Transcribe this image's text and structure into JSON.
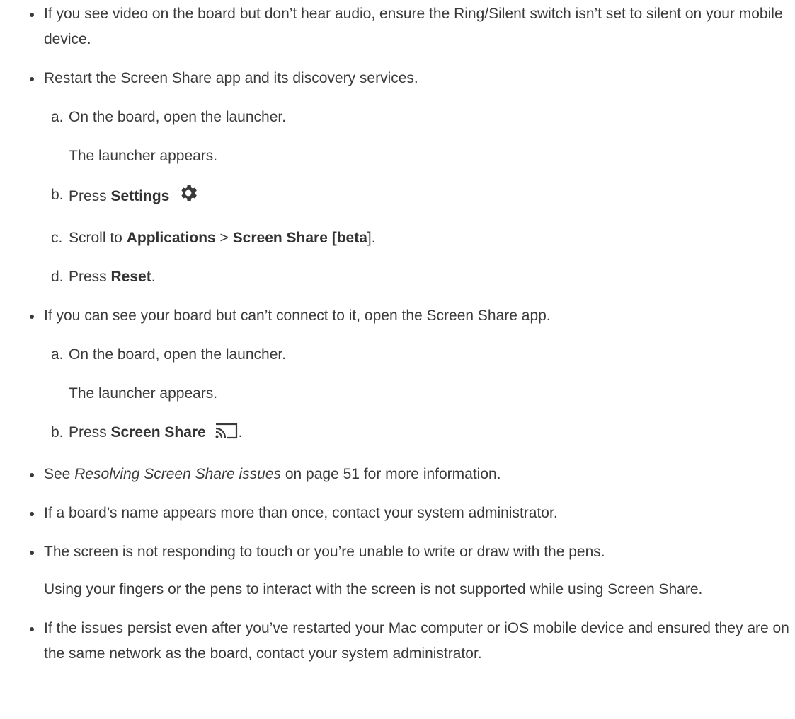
{
  "items": {
    "audio": {
      "text": "If you see video on the board but don’t hear audio, ensure the Ring/Silent switch isn’t set to silent on your mobile device."
    },
    "restart": {
      "text": "Restart the Screen Share app and its discovery services."
    },
    "restart_steps": {
      "a": {
        "marker": "a.",
        "text": "On the board, open the launcher."
      },
      "a_result": "The launcher appears.",
      "b": {
        "marker": "b.",
        "pre": "Press ",
        "bold": "Settings",
        "icon": "gear-icon"
      },
      "c": {
        "marker": "c.",
        "pre": "Scroll to ",
        "bold1": "Applications",
        "sep": " > ",
        "bold2": "Screen Share [beta",
        "post_bold": "]",
        "end": "."
      },
      "d": {
        "marker": "d.",
        "pre": "Press ",
        "bold": "Reset",
        "end": "."
      }
    },
    "cant_connect": {
      "text": "If you can see your board but can’t connect to it, open the Screen Share app."
    },
    "connect_steps": {
      "a": {
        "marker": "a.",
        "text": "On the board, open the launcher."
      },
      "a_result": "The launcher appears.",
      "b": {
        "marker": "b.",
        "pre": "Press ",
        "bold": "Screen Share",
        "icon": "screen-share-icon",
        "end": "."
      }
    },
    "see_also": {
      "pre": "See ",
      "italic": "Resolving Screen Share issues",
      "post": " on page 51 for more information."
    },
    "name_twice": {
      "text": "If a board’s name appears more than once, contact your system administrator."
    },
    "touch": {
      "text": "The screen is not responding to touch or you’re unable to write or draw with the pens."
    },
    "touch_note": "Using your fingers or the pens to interact with the screen is not supported while using Screen Share.",
    "persist": {
      "text": "If the issues persist even after you’ve restarted your Mac computer or iOS mobile device and ensured they are on the same network as the board, contact your system administrator."
    }
  }
}
